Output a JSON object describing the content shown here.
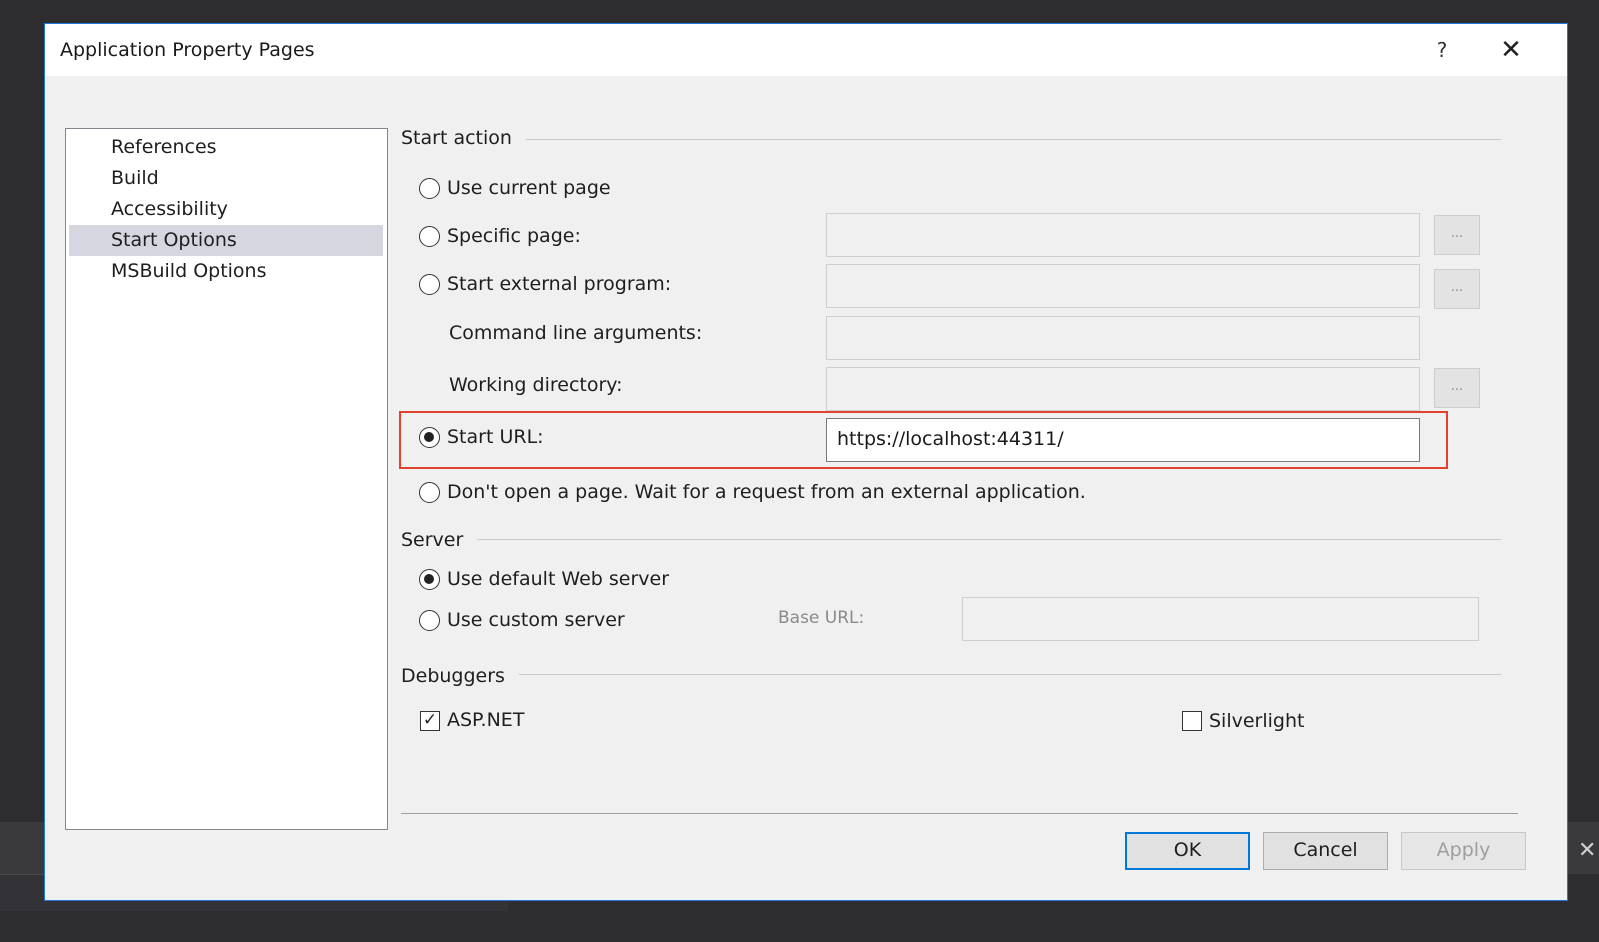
{
  "dialog": {
    "title": "Application Property Pages",
    "help_label": "?",
    "close_label": "✕"
  },
  "nav": {
    "items": [
      {
        "label": "References",
        "selected": false
      },
      {
        "label": "Build",
        "selected": false
      },
      {
        "label": "Accessibility",
        "selected": false
      },
      {
        "label": "Start Options",
        "selected": true
      },
      {
        "label": "MSBuild Options",
        "selected": false
      }
    ]
  },
  "start_action": {
    "group_label": "Start action",
    "use_current_page": {
      "label": "Use current page",
      "selected": false
    },
    "specific_page": {
      "label": "Specific page:",
      "selected": false,
      "value": "",
      "browse_label": "..."
    },
    "start_external_program": {
      "label": "Start external program:",
      "selected": false,
      "value": "",
      "browse_label": "..."
    },
    "command_line_arguments": {
      "label": "Command line arguments:",
      "value": ""
    },
    "working_directory": {
      "label": "Working directory:",
      "value": "",
      "browse_label": "..."
    },
    "start_url": {
      "label": "Start URL:",
      "selected": true,
      "value": "https://localhost:44311/"
    },
    "dont_open": {
      "label": "Don't open a page. Wait for a request from an external application.",
      "selected": false
    }
  },
  "server": {
    "group_label": "Server",
    "use_default": {
      "label": "Use default Web server",
      "selected": true
    },
    "use_custom": {
      "label": "Use custom server",
      "selected": false
    },
    "base_url": {
      "label": "Base URL:",
      "value": ""
    }
  },
  "debuggers": {
    "group_label": "Debuggers",
    "aspnet": {
      "label": "ASP.NET",
      "checked": true
    },
    "silverlight": {
      "label": "Silverlight",
      "checked": false
    }
  },
  "buttons": {
    "ok": "OK",
    "cancel": "Cancel",
    "apply": "Apply"
  },
  "colors": {
    "highlight": "#e2412f",
    "accent": "#0078d7"
  }
}
